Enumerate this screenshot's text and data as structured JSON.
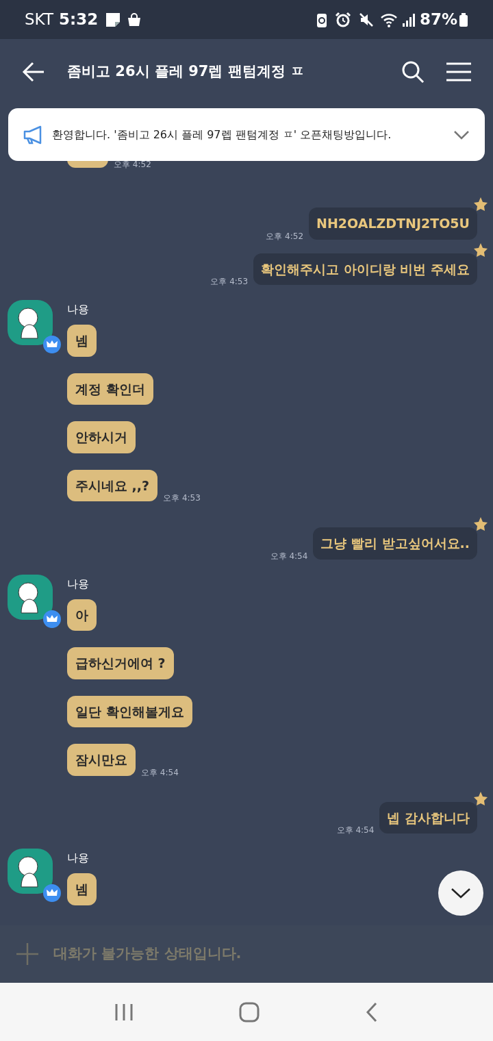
{
  "status_bar": {
    "carrier": "SKT",
    "time": "5:32",
    "battery": "87%"
  },
  "header": {
    "title": "좀비고 26시 플레 97렙 팬텀계정 ㅍ"
  },
  "notice": {
    "text": "환영합니다. '좀비고 26시 플레 97렙 팬텀계정 ㅍ' 오픈채팅방입니다."
  },
  "messages": [
    {
      "kind": "received",
      "time": "오후 4:52"
    },
    {
      "kind": "sent",
      "text": "NH2OALZDTNJ2TO5U",
      "time": "오후 4:52"
    },
    {
      "kind": "sent",
      "text": "확인해주시고 아이디랑 비번 주세요",
      "time": "오후 4:53"
    },
    {
      "kind": "received",
      "author": "나용",
      "bubbles": [
        "넴",
        "계정 확인더",
        "안하시거",
        "주시네요 ,,?"
      ],
      "time": "오후 4:53"
    },
    {
      "kind": "sent",
      "text": "그냥 빨리 받고싶어서요..",
      "time": "오후 4:54"
    },
    {
      "kind": "received",
      "author": "나용",
      "bubbles": [
        "아",
        "급하신거에여 ?",
        "일단 확인해볼게요",
        "잠시만요"
      ],
      "time": "오후 4:54"
    },
    {
      "kind": "sent",
      "text": "넵 감사합니다",
      "time": "오후 4:54"
    },
    {
      "kind": "received",
      "author": "나용",
      "bubbles": [
        "넴"
      ]
    }
  ],
  "composer": {
    "placeholder": "대화가 불가능한 상태입니다."
  }
}
